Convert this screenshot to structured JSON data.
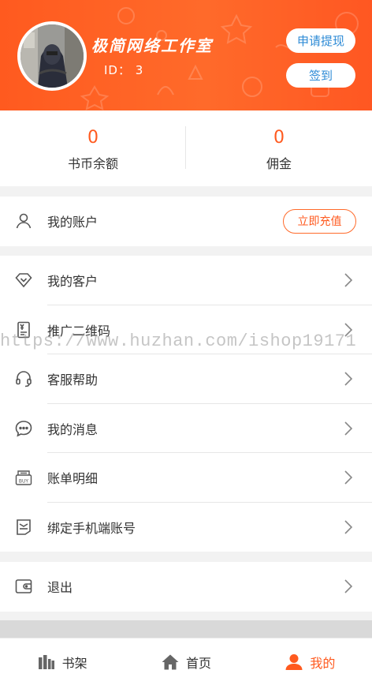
{
  "profile": {
    "nickname": "极简网络工作室",
    "user_id": "ID：  3",
    "withdraw_label": "申请提现",
    "signin_label": "签到"
  },
  "stats": [
    {
      "value": "0",
      "label": "书币余额"
    },
    {
      "value": "0",
      "label": "佣金"
    }
  ],
  "account": {
    "label": "我的账户",
    "recharge_label": "立即充值"
  },
  "menu": [
    {
      "label": "我的客户",
      "icon": "diamond-icon"
    },
    {
      "label": "推广二维码",
      "icon": "qrcode-icon"
    },
    {
      "label": "客服帮助",
      "icon": "headset-icon"
    },
    {
      "label": "我的消息",
      "icon": "chat-bubble-icon"
    },
    {
      "label": "账单明细",
      "icon": "bill-icon"
    },
    {
      "label": "绑定手机端账号",
      "icon": "bind-phone-icon"
    }
  ],
  "logout": {
    "label": "退出",
    "icon": "wallet-icon"
  },
  "tabbar": [
    {
      "label": "书架",
      "icon": "bookshelf-icon",
      "active": false
    },
    {
      "label": "首页",
      "icon": "home-icon",
      "active": false
    },
    {
      "label": "我的",
      "icon": "user-icon",
      "active": true
    }
  ],
  "watermark": "https://www.huzhan.com/ishop19171",
  "colors": {
    "accent": "#ff5a1f",
    "link_blue": "#2e8bd6"
  }
}
